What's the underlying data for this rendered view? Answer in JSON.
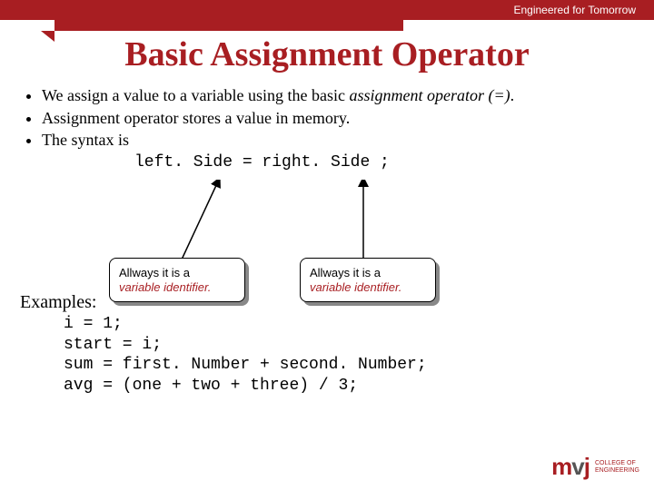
{
  "header": {
    "tagline": "Engineered for Tomorrow"
  },
  "title": "Basic Assignment Operator",
  "bullets": {
    "b1_pre": "We assign a value to a variable using the basic ",
    "b1_em": "assignment operator (=)",
    "b1_post": ".",
    "b2": "Assignment operator stores a value in memory.",
    "b3": "The syntax is"
  },
  "syntax": "left. Side = right. Side ;",
  "callouts": {
    "left_line1": "Allways it is a",
    "left_line2": "variable identifier.",
    "right_line1": "Allways it is a",
    "right_line2": "variable identifier."
  },
  "examples_label": "Examples:",
  "code": "i = 1;\nstart = i;\nsum = first. Number + second. Number;\navg = (one + two + three) / 3;",
  "logo": {
    "mark_m": "m",
    "mark_v": "v",
    "mark_j": "j",
    "text1": "COLLEGE OF",
    "text2": "ENGINEERING"
  }
}
